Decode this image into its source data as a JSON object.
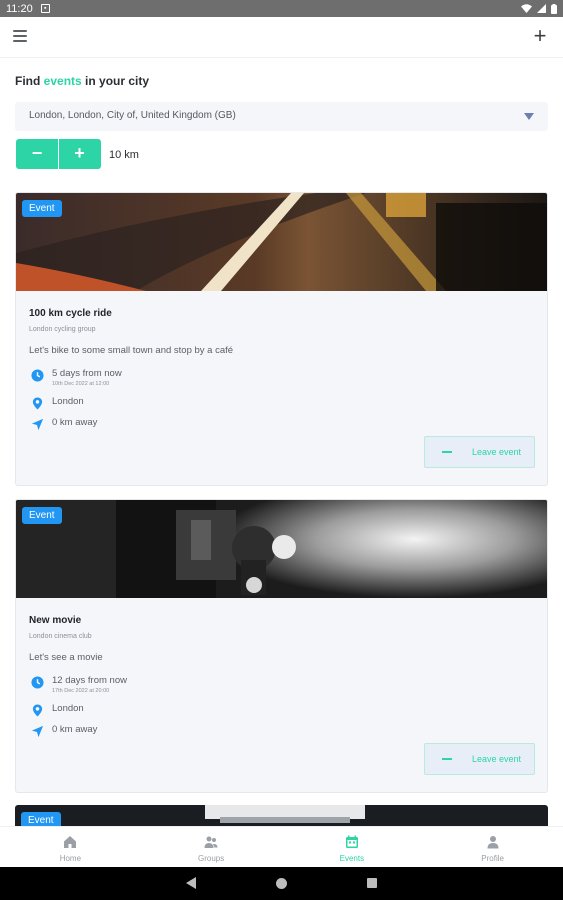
{
  "status_bar": {
    "time": "11:20"
  },
  "page": {
    "heading_prefix": "Find ",
    "heading_accent": "events",
    "heading_suffix": " in your city",
    "location": "London, London, City of, United Kingdom (GB)",
    "stepper_minus": "−",
    "stepper_plus": "+",
    "radius": "10 km"
  },
  "events": [
    {
      "badge": "Event",
      "title": "100 km cycle ride",
      "group": "London cycling group",
      "description": "Let's bike to some small town and stop by a café",
      "when": "5 days from now",
      "date": "10th Dec 2022 at 12:00",
      "place": "London",
      "distance": "0 km away",
      "action": "Leave event"
    },
    {
      "badge": "Event",
      "title": "New movie",
      "group": "London cinema club",
      "description": "Let's see a movie",
      "when": "12 days from now",
      "date": "17th Dec 2022 at 20:00",
      "place": "London",
      "distance": "0 km away",
      "action": "Leave event"
    },
    {
      "badge": "Event"
    }
  ],
  "bottom_nav": [
    {
      "label": "Home",
      "icon": "home-icon"
    },
    {
      "label": "Groups",
      "icon": "groups-icon"
    },
    {
      "label": "Events",
      "icon": "calendar-icon",
      "active": true
    },
    {
      "label": "Profile",
      "icon": "person-icon"
    }
  ],
  "colors": {
    "accent": "#2dd4a6",
    "badge": "#2196f3",
    "card_bg": "#f4f6fa"
  }
}
